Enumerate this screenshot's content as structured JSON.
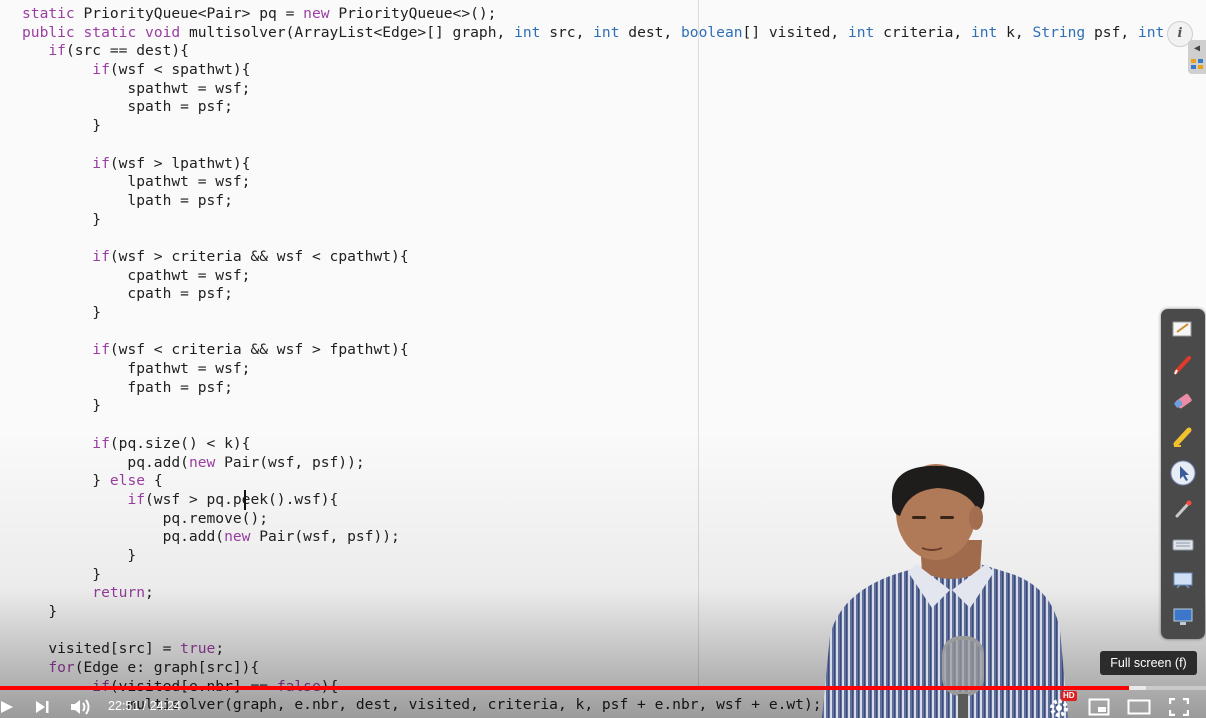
{
  "code": {
    "lines": [
      "static PriorityQueue<Pair> pq = new PriorityQueue<>();",
      "public static void multisolver(ArrayList<Edge>[] graph, int src, int dest, boolean[] visited, int criteria, int k, String psf, int",
      "   if(src == dest){",
      "        if(wsf < spathwt){",
      "            spathwt = wsf;",
      "            spath = psf;",
      "        }",
      "",
      "        if(wsf > lpathwt){",
      "            lpathwt = wsf;",
      "            lpath = psf;",
      "        }",
      "",
      "        if(wsf > criteria && wsf < cpathwt){",
      "            cpathwt = wsf;",
      "            cpath = psf;",
      "        }",
      "",
      "        if(wsf < criteria && wsf > fpathwt){",
      "            fpathwt = wsf;",
      "            fpath = psf;",
      "        }",
      "",
      "        if(pq.size() < k){",
      "            pq.add(new Pair(wsf, psf));",
      "        } else {",
      "            if(wsf > pq.peek().wsf){",
      "                pq.remove();",
      "                pq.add(new Pair(wsf, psf));",
      "            }",
      "        }",
      "        return;",
      "   }",
      "",
      "   visited[src] = true;",
      "   for(Edge e: graph[src]){",
      "        if(visited[e.nbr] == false){",
      "            multisolver(graph, e.nbr, dest, visited, criteria, k, psf + e.nbr, wsf + e.wt);"
    ]
  },
  "player": {
    "time": "22:51 / 24:24",
    "progress_fraction": 0.936,
    "buffered_fraction": 0.95,
    "tooltip": "Full screen (f)",
    "hd_badge": "HD",
    "controls": [
      "play-icon",
      "next-icon",
      "volume-icon",
      "settings-icon",
      "miniplayer-icon",
      "theater-icon",
      "fullscreen-icon"
    ]
  },
  "annotation_toolbar": {
    "tools": [
      "notes-icon",
      "pen-icon",
      "eraser-icon",
      "highlighter-icon",
      "pointer-icon",
      "laser-icon",
      "keyboard-icon",
      "whiteboard-icon",
      "screen-icon",
      "layers-icon"
    ]
  },
  "colors": {
    "keyword": "#9b3ea3",
    "type": "#2f6fb5",
    "progress": "#ff0000",
    "toolbar_bg": "#4a4a4a"
  },
  "info_label": "i"
}
